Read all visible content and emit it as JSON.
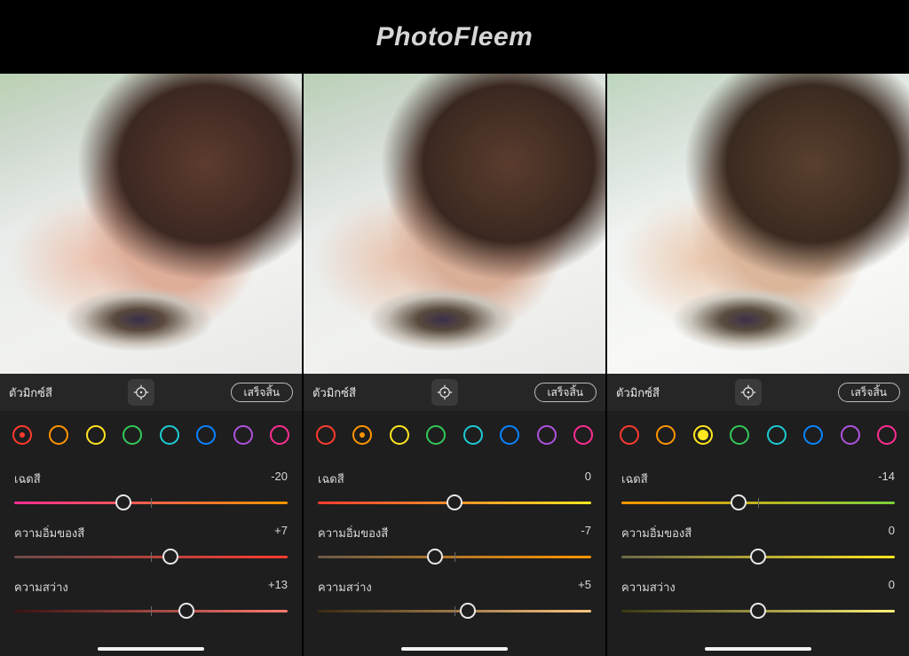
{
  "brand": "PhotoFleem",
  "colors": {
    "red": "#ff3b30",
    "orange": "#ff9500",
    "yellow": "#ffe620",
    "green": "#34c759",
    "aqua": "#1ecad3",
    "blue": "#0a84ff",
    "purple": "#af52de",
    "magenta": "#ff2d92"
  },
  "labels": {
    "panel_title": "ตัวมิกซ์สี",
    "done": "เสร็จสิ้น",
    "hue": "เฉดสี",
    "saturation": "ความอิ่มของสี",
    "luminance": "ความสว่าง"
  },
  "panels": [
    {
      "selected_color": "red",
      "sliders": {
        "hue": {
          "value": "-20",
          "pos": 40,
          "g0": "#ff2d92",
          "g1": "#ff9500"
        },
        "sat": {
          "value": "+7",
          "pos": 57,
          "g0": "#6b4a48",
          "g1": "#ff3b30"
        },
        "lum": {
          "value": "+13",
          "pos": 63,
          "g0": "#3a1212",
          "g1": "#ff7a70"
        }
      }
    },
    {
      "selected_color": "orange",
      "sliders": {
        "hue": {
          "value": "0",
          "pos": 50,
          "g0": "#ff3b30",
          "g1": "#ffe620"
        },
        "sat": {
          "value": "-7",
          "pos": 43,
          "g0": "#6b5a48",
          "g1": "#ff9500"
        },
        "lum": {
          "value": "+5",
          "pos": 55,
          "g0": "#3a2a12",
          "g1": "#ffc680"
        }
      }
    },
    {
      "selected_color": "yellow",
      "sliders": {
        "hue": {
          "value": "-14",
          "pos": 43,
          "g0": "#ff9500",
          "g1": "#7bd13c"
        },
        "sat": {
          "value": "0",
          "pos": 50,
          "g0": "#6b6848",
          "g1": "#ffe620"
        },
        "lum": {
          "value": "0",
          "pos": 50,
          "g0": "#3a3812",
          "g1": "#fff27a"
        }
      }
    }
  ]
}
